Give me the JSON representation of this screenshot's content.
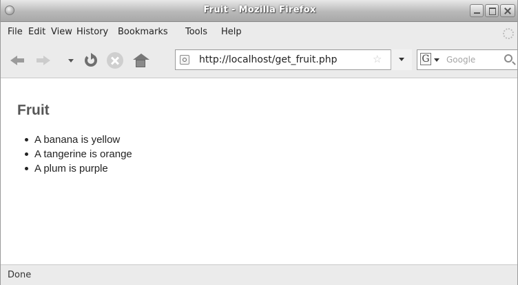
{
  "window": {
    "title": "Fruit - Mozilla Firefox"
  },
  "menu": {
    "items": [
      {
        "label": "File"
      },
      {
        "label": "Edit"
      },
      {
        "label": "View"
      },
      {
        "label": "History"
      },
      {
        "label": "Bookmarks"
      },
      {
        "label": "Tools"
      },
      {
        "label": "Help"
      }
    ]
  },
  "navigation": {
    "url": "http://localhost/get_fruit.php",
    "search_placeholder": "Google",
    "search_engine_letter": "G",
    "icons": [
      "back-arrow-icon",
      "forward-arrow-icon",
      "history-dropdown-icon",
      "reload-icon",
      "stop-icon",
      "home-icon",
      "site-identity-icon",
      "star-icon",
      "search-icon"
    ]
  },
  "page": {
    "heading": "Fruit",
    "items": [
      "A banana is yellow",
      "A tangerine is orange",
      "A plum is purple"
    ]
  },
  "status": {
    "text": "Done"
  }
}
